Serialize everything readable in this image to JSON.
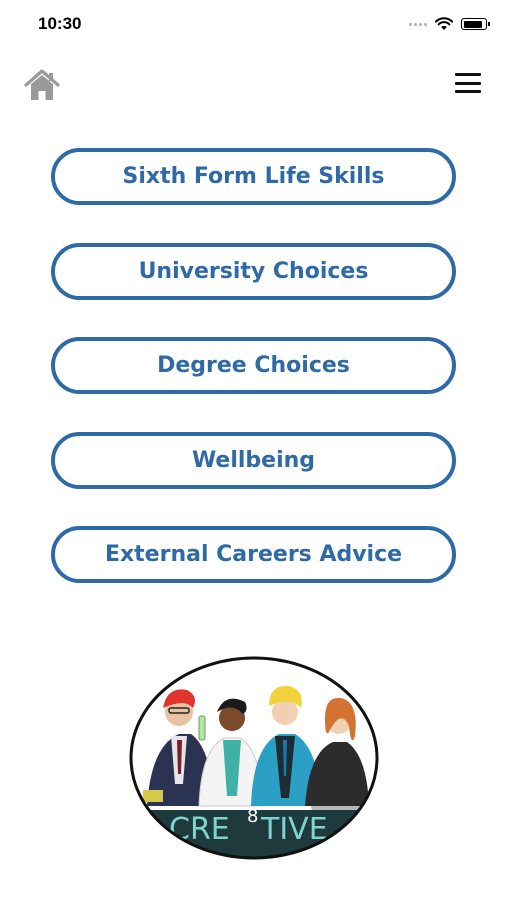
{
  "status_bar": {
    "time": "10:30",
    "icons": [
      "signal-dots-icon",
      "wifi-icon",
      "battery-icon"
    ],
    "battery_level": 0.9
  },
  "nav": {
    "home_icon": "house-icon",
    "menu_icon": "hamburger-menu-icon"
  },
  "menu": {
    "items": [
      {
        "label": "Sixth Form Life Skills"
      },
      {
        "label": "University Choices"
      },
      {
        "label": "Degree Choices"
      },
      {
        "label": "Wellbeing"
      },
      {
        "label": "External Careers Advice"
      }
    ]
  },
  "logo": {
    "text_left": "CRE",
    "text_sup": "8",
    "text_right": "TIVE"
  },
  "colors": {
    "accent": "#2f6aa8",
    "home_icon": "#9a9a9a",
    "logo_band": "#1e3a3c",
    "logo_text": "#7fd3cf"
  }
}
